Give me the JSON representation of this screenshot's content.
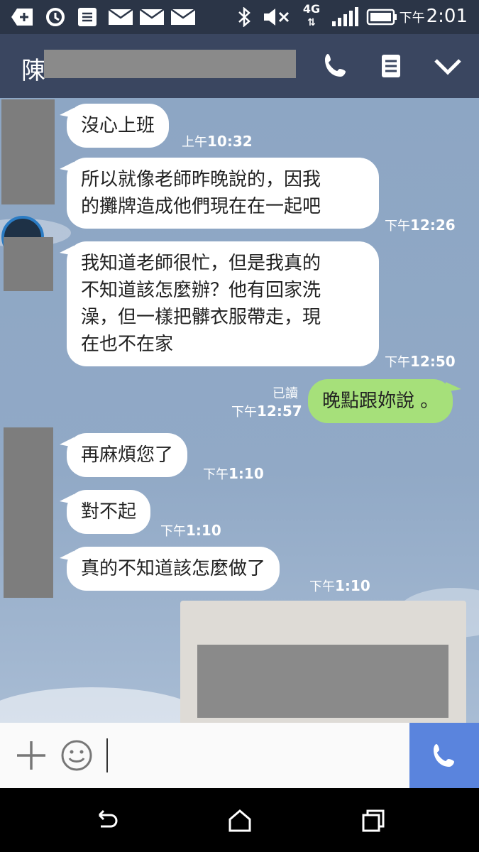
{
  "status_bar": {
    "time_period": "下午",
    "time": "2:01",
    "network": "4G",
    "icons": [
      "add-icon",
      "sync-icon",
      "note-icon",
      "mail-icon",
      "mail-icon",
      "mail-icon",
      "bluetooth-icon",
      "mute-icon",
      "4g-icon",
      "signal-icon",
      "battery-icon"
    ]
  },
  "header": {
    "contact_initial": "陳",
    "icons": [
      "phone-icon",
      "menu-icon",
      "chevron-down-icon"
    ]
  },
  "messages": [
    {
      "direction": "in",
      "text": "沒心上班",
      "time_period": "上午",
      "time": "10:32"
    },
    {
      "direction": "in",
      "lines": [
        "所以就像老師昨晚說的，因我",
        "的攤牌造成他們現在在一起吧"
      ],
      "time_period": "下午",
      "time": "12:26"
    },
    {
      "direction": "in",
      "lines": [
        "我知道老師很忙，但是我真的",
        "不知道該怎麼辦？他有回家洗",
        "澡，但一樣把髒衣服帶走，現",
        "在也不在家"
      ],
      "time_period": "下午",
      "time": "12:50"
    },
    {
      "direction": "out",
      "text": "晚點跟妳說 。",
      "read_label": "已讀",
      "time_period": "下午",
      "time": "12:57"
    },
    {
      "direction": "in",
      "text": "再麻煩您了",
      "time_period": "下午",
      "time": "1:10"
    },
    {
      "direction": "in",
      "text": "對不起",
      "time_period": "下午",
      "time": "1:10"
    },
    {
      "direction": "in",
      "text": "真的不知道該怎麼做了",
      "time_period": "下午",
      "time": "1:10"
    }
  ],
  "input_bar": {
    "icons": [
      "plus-icon",
      "emoji-icon",
      "call-icon"
    ],
    "value": ""
  },
  "nav_bar": {
    "icons": [
      "back-icon",
      "home-icon",
      "recents-icon"
    ]
  },
  "colors": {
    "header": "#3a4660",
    "chat_background": "#8da6c4",
    "outgoing_bubble": "#a6e07a",
    "call_button": "#5a84dd"
  }
}
